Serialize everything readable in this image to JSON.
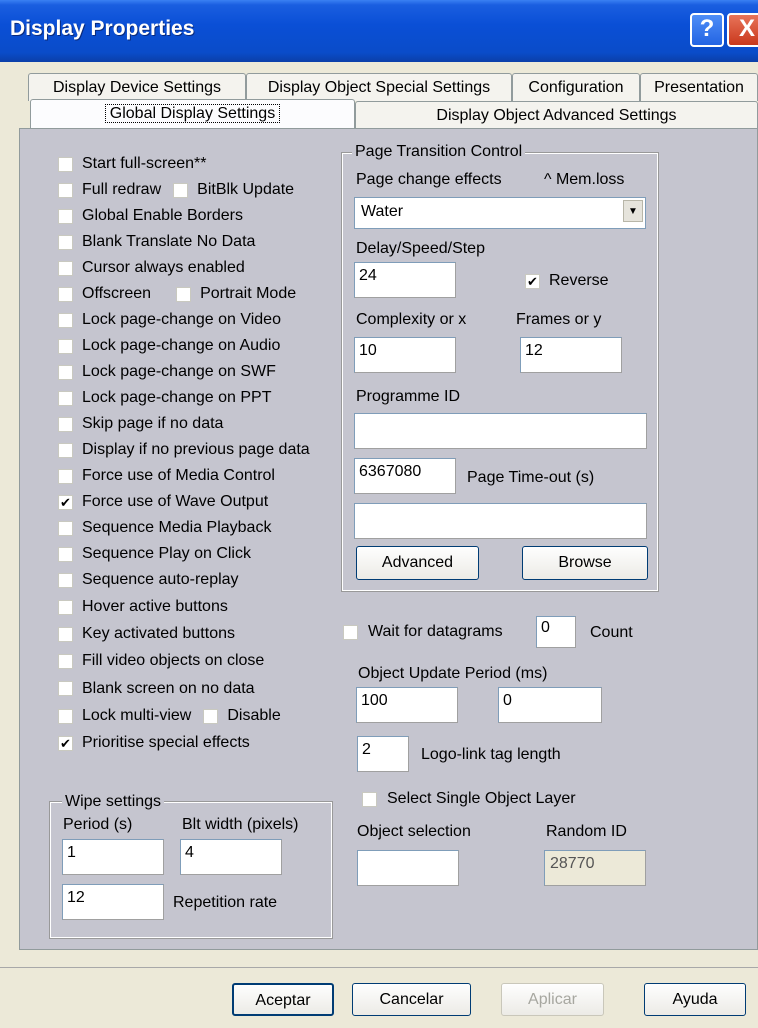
{
  "window": {
    "title": "Display Properties",
    "help_glyph": "?",
    "close_glyph": "X"
  },
  "tabs": {
    "row1": [
      "Display Device Settings",
      "Display Object Special Settings",
      "Configuration",
      "Presentation"
    ],
    "row2": [
      "Global Display Settings",
      "Display Object Advanced Settings"
    ],
    "active": "Global Display Settings"
  },
  "options": [
    {
      "label": "Start full-screen**",
      "checked": false
    },
    {
      "label": "Full redraw",
      "checked": false
    },
    {
      "label": "Global Enable Borders",
      "checked": false
    },
    {
      "label": "Blank Translate No Data",
      "checked": false
    },
    {
      "label": "Cursor always enabled",
      "checked": false
    },
    {
      "label": "Offscreen",
      "checked": false
    },
    {
      "label": "Lock page-change on Video",
      "checked": false
    },
    {
      "label": "Lock page-change on Audio",
      "checked": false
    },
    {
      "label": "Lock page-change on SWF",
      "checked": false
    },
    {
      "label": "Lock page-change on PPT",
      "checked": false
    },
    {
      "label": "Skip page if no data",
      "checked": false
    },
    {
      "label": "Display if no previous page data",
      "checked": false
    },
    {
      "label": "Force use of Media Control",
      "checked": false
    },
    {
      "label": "Force use of Wave Output",
      "checked": true
    },
    {
      "label": "Sequence Media Playback",
      "checked": false
    },
    {
      "label": "Sequence Play on Click",
      "checked": false
    },
    {
      "label": "Sequence auto-replay",
      "checked": false
    },
    {
      "label": "Hover active buttons",
      "checked": false
    },
    {
      "label": "Key activated buttons",
      "checked": false
    },
    {
      "label": "Fill video objects on close",
      "checked": false
    },
    {
      "label": "Blank screen on no data",
      "checked": false
    },
    {
      "label": "Lock multi-view",
      "checked": false
    },
    {
      "label": "Prioritise special effects",
      "checked": true
    }
  ],
  "inline_options": {
    "bitblk": {
      "label": "BitBlk Update",
      "checked": false
    },
    "portrait": {
      "label": "Portrait Mode",
      "checked": false
    },
    "disable": {
      "label": "Disable",
      "checked": false
    }
  },
  "wipe": {
    "title": "Wipe settings",
    "period_label": "Period (s)",
    "period_value": "1",
    "blt_label": "Blt width (pixels)",
    "blt_value": "4",
    "rate_value": "12",
    "rate_label": "Repetition rate"
  },
  "page_transition": {
    "title": "Page Transition Control",
    "effects_label": "Page change effects",
    "memloss_label": "^ Mem.loss",
    "effect_value": "Water",
    "delay_label": "Delay/Speed/Step",
    "delay_value": "24",
    "reverse_label": "Reverse",
    "reverse_checked": true,
    "complexity_label": "Complexity or x",
    "complexity_value": "10",
    "frames_label": "Frames or y",
    "frames_value": "12",
    "programme_label": "Programme ID",
    "programme_value": "",
    "timeout_value": "6367080",
    "timeout_label": "Page Time-out (s)",
    "extra_value": "",
    "advanced_label": "Advanced",
    "browse_label": "Browse"
  },
  "datagrams": {
    "label": "Wait for datagrams",
    "checked": false,
    "count_value": "0",
    "count_label": "Count"
  },
  "update_period": {
    "label": "Object Update Period (ms)",
    "value1": "100",
    "value2": "0"
  },
  "logo_link": {
    "value": "2",
    "label": "Logo-link tag length"
  },
  "single_layer": {
    "label": "Select Single Object Layer",
    "checked": false
  },
  "object_selection": {
    "label": "Object selection",
    "value": ""
  },
  "random_id": {
    "label": "Random ID",
    "value": "28770"
  },
  "buttons": {
    "ok": "Aceptar",
    "cancel": "Cancelar",
    "apply": "Aplicar",
    "help": "Ayuda"
  }
}
